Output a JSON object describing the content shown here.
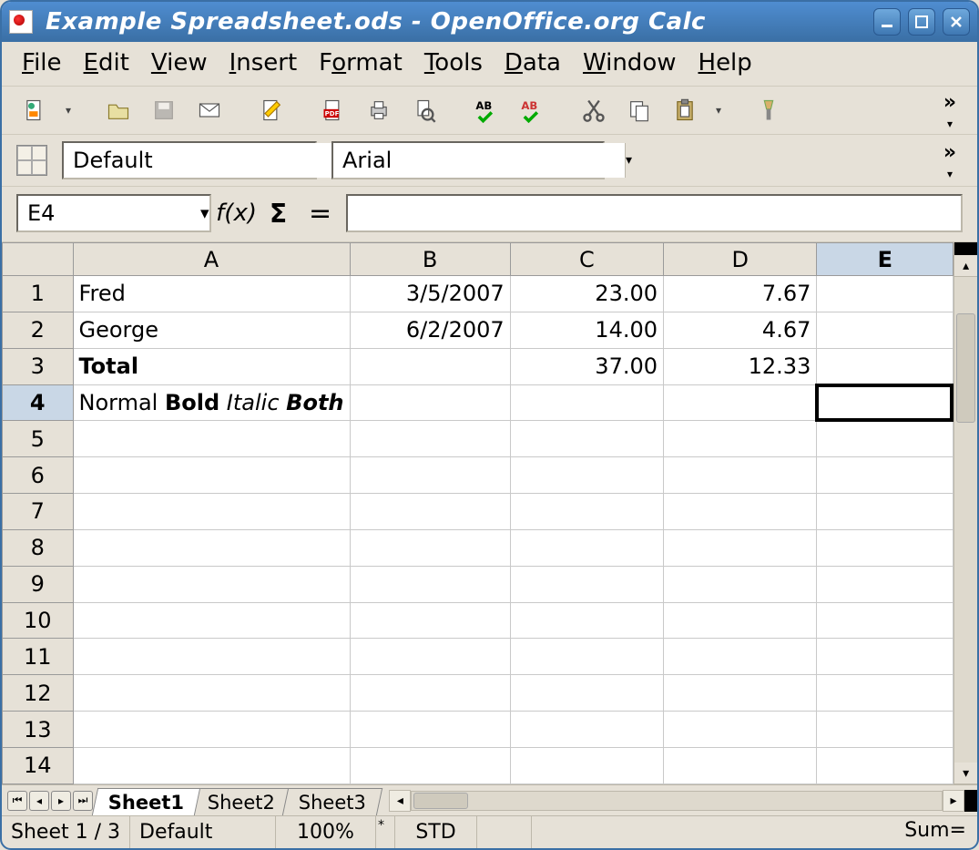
{
  "titlebar": {
    "title": "Example Spreadsheet.ods - OpenOffice.org Calc"
  },
  "menu": [
    "File",
    "Edit",
    "View",
    "Insert",
    "Format",
    "Tools",
    "Data",
    "Window",
    "Help"
  ],
  "style_row": {
    "style": "Default",
    "font": "Arial"
  },
  "formula": {
    "cell_ref": "E4",
    "fx_label": "f(x)",
    "sigma_label": "Σ",
    "eq_label": "=",
    "formula_value": ""
  },
  "columns": [
    "A",
    "B",
    "C",
    "D",
    "E"
  ],
  "row_count": 14,
  "active": {
    "row": 4,
    "col": "E"
  },
  "cells": {
    "1": {
      "A": "Fred",
      "B": "3/5/2007",
      "C": "23.00",
      "D": "7.67"
    },
    "2": {
      "A": "George",
      "B": "6/2/2007",
      "C": "14.00",
      "D": "4.67"
    },
    "3": {
      "A_bold": "Total",
      "C": "37.00",
      "D": "12.33"
    },
    "4": {
      "A_rich": [
        "Normal ",
        {
          "t": "Bold",
          "b": true
        },
        " ",
        {
          "t": "Italic",
          "i": true
        },
        " ",
        {
          "t": "Both",
          "b": true,
          "i": true
        }
      ]
    }
  },
  "tabs": {
    "nav": [
      "first",
      "prev",
      "next",
      "last"
    ],
    "sheets": [
      "Sheet1",
      "Sheet2",
      "Sheet3"
    ],
    "active": "Sheet1"
  },
  "status": {
    "sheet_pos": "Sheet 1 / 3",
    "page_style": "Default",
    "zoom": "100%",
    "mode": "STD",
    "sum": "Sum="
  }
}
